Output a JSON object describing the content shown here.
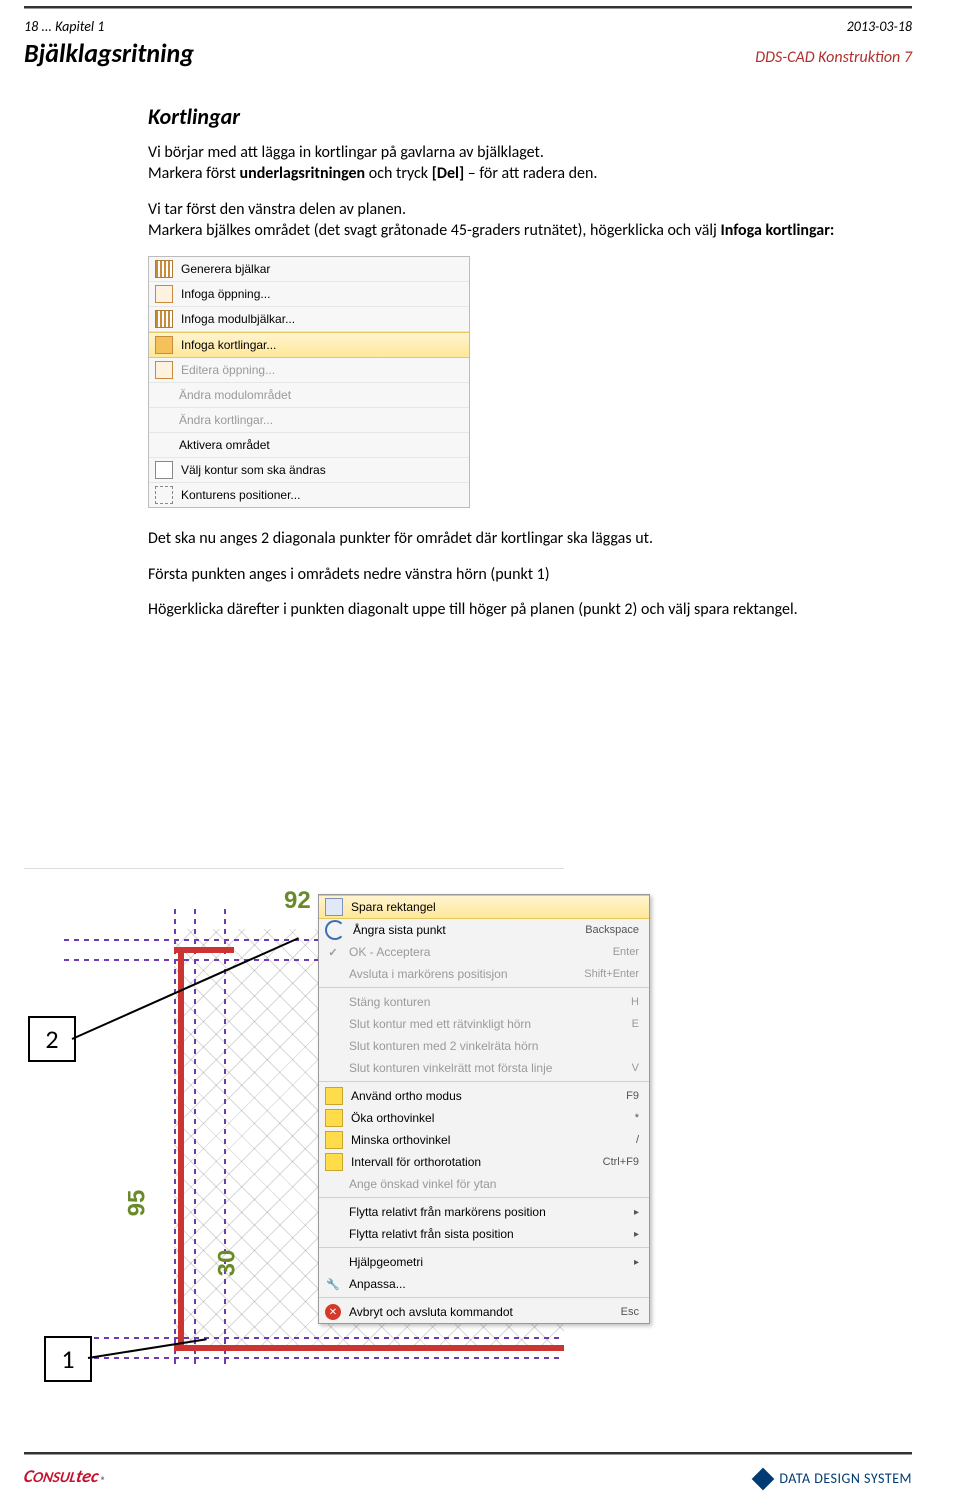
{
  "header": {
    "pageinfo": "18 ... Kapitel 1",
    "date": "2013-03-18",
    "title": "Bjälklagsritning",
    "product": "DDS-CAD Konstruktion 7"
  },
  "body": {
    "h": "Kortlingar",
    "p1a": "Vi börjar med att lägga in kortlingar på gavlarna av bjälklaget.",
    "p1b_1": "Markera först ",
    "p1b_2": "underlagsritningen",
    "p1b_3": " och tryck ",
    "p1b_4": "[Del]",
    "p1b_5": " – för att radera den.",
    "p2_1": "Vi tar först den vänstra delen av planen.",
    "p2_2": "Markera bjälkes området (det svagt gråtonade 45-graders rutnätet), högerklicka och välj ",
    "p2_3": "Infoga kortlingar:",
    "p3": "Det ska nu anges 2 diagonala punkter för området där kortlingar ska läggas ut.",
    "p4": "Första punkten anges i områdets nedre vänstra hörn (punkt 1)",
    "p5": "Högerklicka därefter i punkten diagonalt uppe till höger på planen (punkt 2) och välj spara rektangel."
  },
  "menu1": {
    "items": [
      {
        "label": "Generera bjälkar",
        "ico": "bars"
      },
      {
        "label": "Infoga öppning...",
        "ico": "box"
      },
      {
        "label": "Infoga modulbjälkar...",
        "ico": "bars"
      },
      {
        "label": "Infoga kortlingar...",
        "ico": "box",
        "hi": true
      },
      {
        "label": "Editera öppning...",
        "ico": "box",
        "dis": true
      },
      {
        "label": "Ändra modulområdet",
        "dis": true
      },
      {
        "label": "Ändra kortlingar...",
        "dis": true
      },
      {
        "label": "Aktivera området"
      },
      {
        "label": "Välj kontur som ska ändras",
        "ico": "sq"
      },
      {
        "label": "Konturens positioner...",
        "ico": "dots"
      }
    ]
  },
  "menu2": {
    "items": [
      {
        "label": "Spara rektangel",
        "ico": "save",
        "hi": true
      },
      {
        "label": "Ångra sista punkt",
        "ico": "undo",
        "sc": "Backspace"
      },
      {
        "label": "OK - Acceptera",
        "ico": "ok",
        "sc": "Enter",
        "dis": true
      },
      {
        "label": "Avsluta i markörens positisjon",
        "sc": "Shift+Enter",
        "dis": true
      },
      {
        "label": "Stäng konturen",
        "sc": "H",
        "dis": true,
        "sep": true
      },
      {
        "label": "Slut kontur med ett rätvinkligt hörn",
        "sc": "E",
        "dis": true
      },
      {
        "label": "Slut konturen med 2 vinkelräta hörn",
        "dis": true
      },
      {
        "label": "Slut konturen vinkelrätt mot första linje",
        "sc": "V",
        "dis": true
      },
      {
        "label": "Använd ortho modus",
        "ico": "y",
        "sc": "F9",
        "sep": true
      },
      {
        "label": "Öka orthovinkel",
        "ico": "y",
        "sc": "*"
      },
      {
        "label": "Minska orthovinkel",
        "ico": "y",
        "sc": "/"
      },
      {
        "label": "Intervall för orthorotation",
        "ico": "y",
        "sc": "Ctrl+F9"
      },
      {
        "label": "Ange önskad vinkel för ytan",
        "dis": true
      },
      {
        "label": "Flytta relativt från markörens position",
        "ar": "▸",
        "sep": true
      },
      {
        "label": "Flytta relativt från sista position",
        "ar": "▸"
      },
      {
        "label": "Hjälpgeometri",
        "ar": "▸",
        "sep": true
      },
      {
        "label": "Anpassa...",
        "ico": "wr"
      },
      {
        "label": "Avbryt och avsluta kommandot",
        "ico": "red",
        "sc": "Esc",
        "sep": true
      }
    ]
  },
  "callouts": {
    "c1": "1",
    "c2": "2"
  },
  "dims": {
    "d1": "92",
    "d2": "95",
    "d3": "30"
  },
  "footer": {
    "left_brand": "Consultec",
    "right_brand": "DATA DESIGN SYSTEM"
  }
}
